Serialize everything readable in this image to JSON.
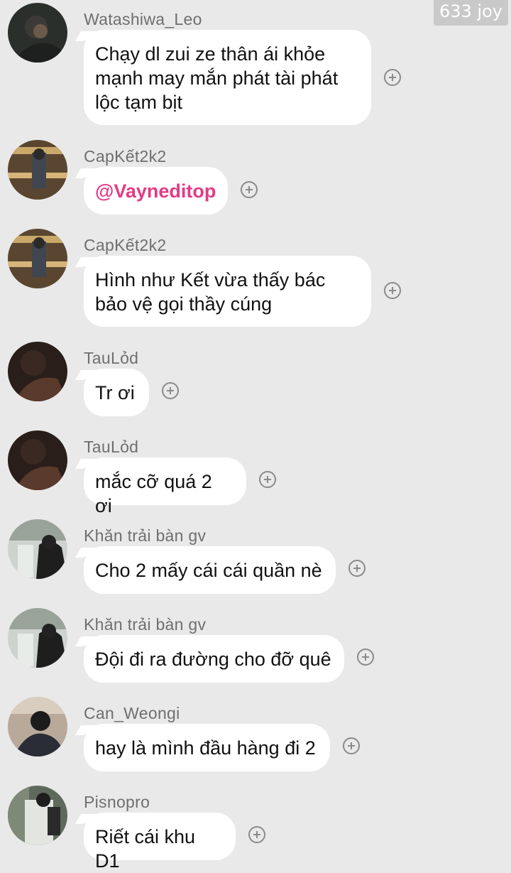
{
  "watermark": "633 joy",
  "messages": [
    {
      "sender": "Watashiwa_Leo",
      "text": "Chạy dl zui ze thân ái khỏe mạnh may mắn phát tài phát lộc tạm bịt",
      "avatar": "avatar-photo"
    },
    {
      "sender": "CapKết2k2",
      "text": "@Vayneditop",
      "mention": true,
      "avatar": "avatar-photo"
    },
    {
      "sender": "CapKết2k2",
      "text": "Hình như Kết vừa thấy bác bảo vệ gọi thầy cúng",
      "avatar": "avatar-photo"
    },
    {
      "sender": "TauLỏd",
      "text": "Tr ơi",
      "avatar": "avatar-photo"
    },
    {
      "sender": "TauLỏd",
      "text": "mắc cỡ quá 2 ơi",
      "avatar": "avatar-photo"
    },
    {
      "sender": "Khăn trải bàn gv",
      "text": "Cho 2 mấy cái cái quần nè",
      "avatar": "avatar-photo"
    },
    {
      "sender": "Khăn trải bàn gv",
      "text": "Đội đi ra đường cho đỡ quê",
      "avatar": "avatar-photo"
    },
    {
      "sender": "Can_Weongi",
      "text": "hay là mình đầu hàng đi 2",
      "avatar": "avatar-photo"
    },
    {
      "sender": "Pisnopro",
      "text": "Riết cái khu D1",
      "avatar": "avatar-photo"
    }
  ],
  "colors": {
    "background": "#e9e9e9",
    "bubble": "#ffffff",
    "mention": "#e23c86",
    "sender": "#6f6f6f"
  },
  "icons": {
    "react": "add-reaction-icon"
  }
}
